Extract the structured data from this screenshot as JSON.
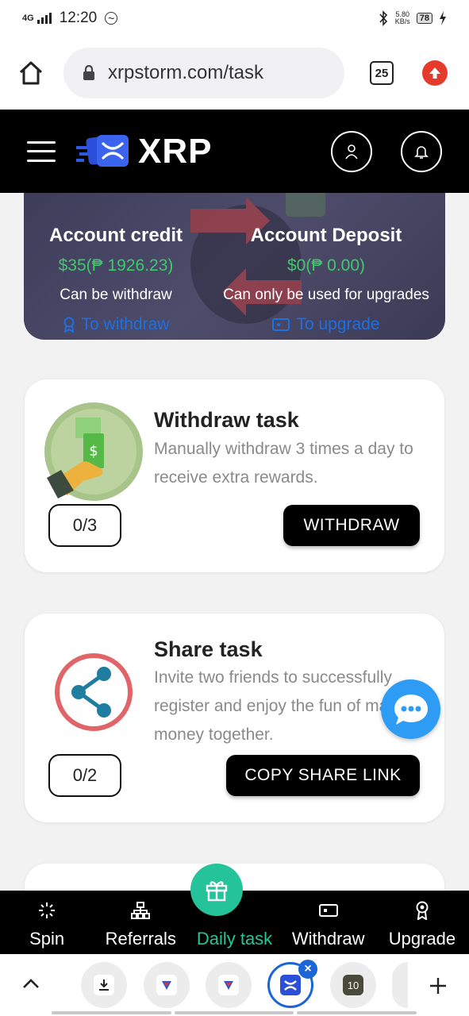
{
  "status_bar": {
    "network": "4G",
    "time": "12:20",
    "speed_value": "5.80",
    "speed_unit": "KB/s",
    "battery": "78"
  },
  "browser": {
    "url": "xrpstorm.com/task",
    "tab_count": "25"
  },
  "header": {
    "logo_text": "XRP"
  },
  "account": {
    "credit_title": "Account credit",
    "credit_value": "$35(₱ 1926.23)",
    "credit_sub": "Can be withdraw",
    "credit_link": "To withdraw",
    "deposit_title": "Account Deposit",
    "deposit_value": "$0(₱ 0.00)",
    "deposit_sub": "Can only be used for upgrades",
    "deposit_link": "To upgrade"
  },
  "tasks": [
    {
      "title": "Withdraw task",
      "desc": "Manually withdraw 3 times a day to receive extra rewards.",
      "progress": "0/3",
      "button": "WITHDRAW"
    },
    {
      "title": "Share task",
      "desc": "Invite two friends to successfully register and enjoy the fun of making money together.",
      "progress": "0/2",
      "button": "COPY SHARE LINK"
    }
  ],
  "bottom_nav": [
    {
      "label": "Spin",
      "icon": "spin-icon"
    },
    {
      "label": "Referrals",
      "icon": "referrals-icon"
    },
    {
      "label": "Daily task",
      "icon": "gift-icon",
      "active": true
    },
    {
      "label": "Withdraw",
      "icon": "wallet-icon"
    },
    {
      "label": "Upgrade",
      "icon": "medal-icon"
    }
  ],
  "tab_strip": {
    "tab_badge": "10"
  },
  "colors": {
    "accent_green": "#27c59a",
    "value_green": "#3ec96b",
    "link_blue": "#1e6fe0",
    "chat_blue": "#2e9cf4"
  }
}
